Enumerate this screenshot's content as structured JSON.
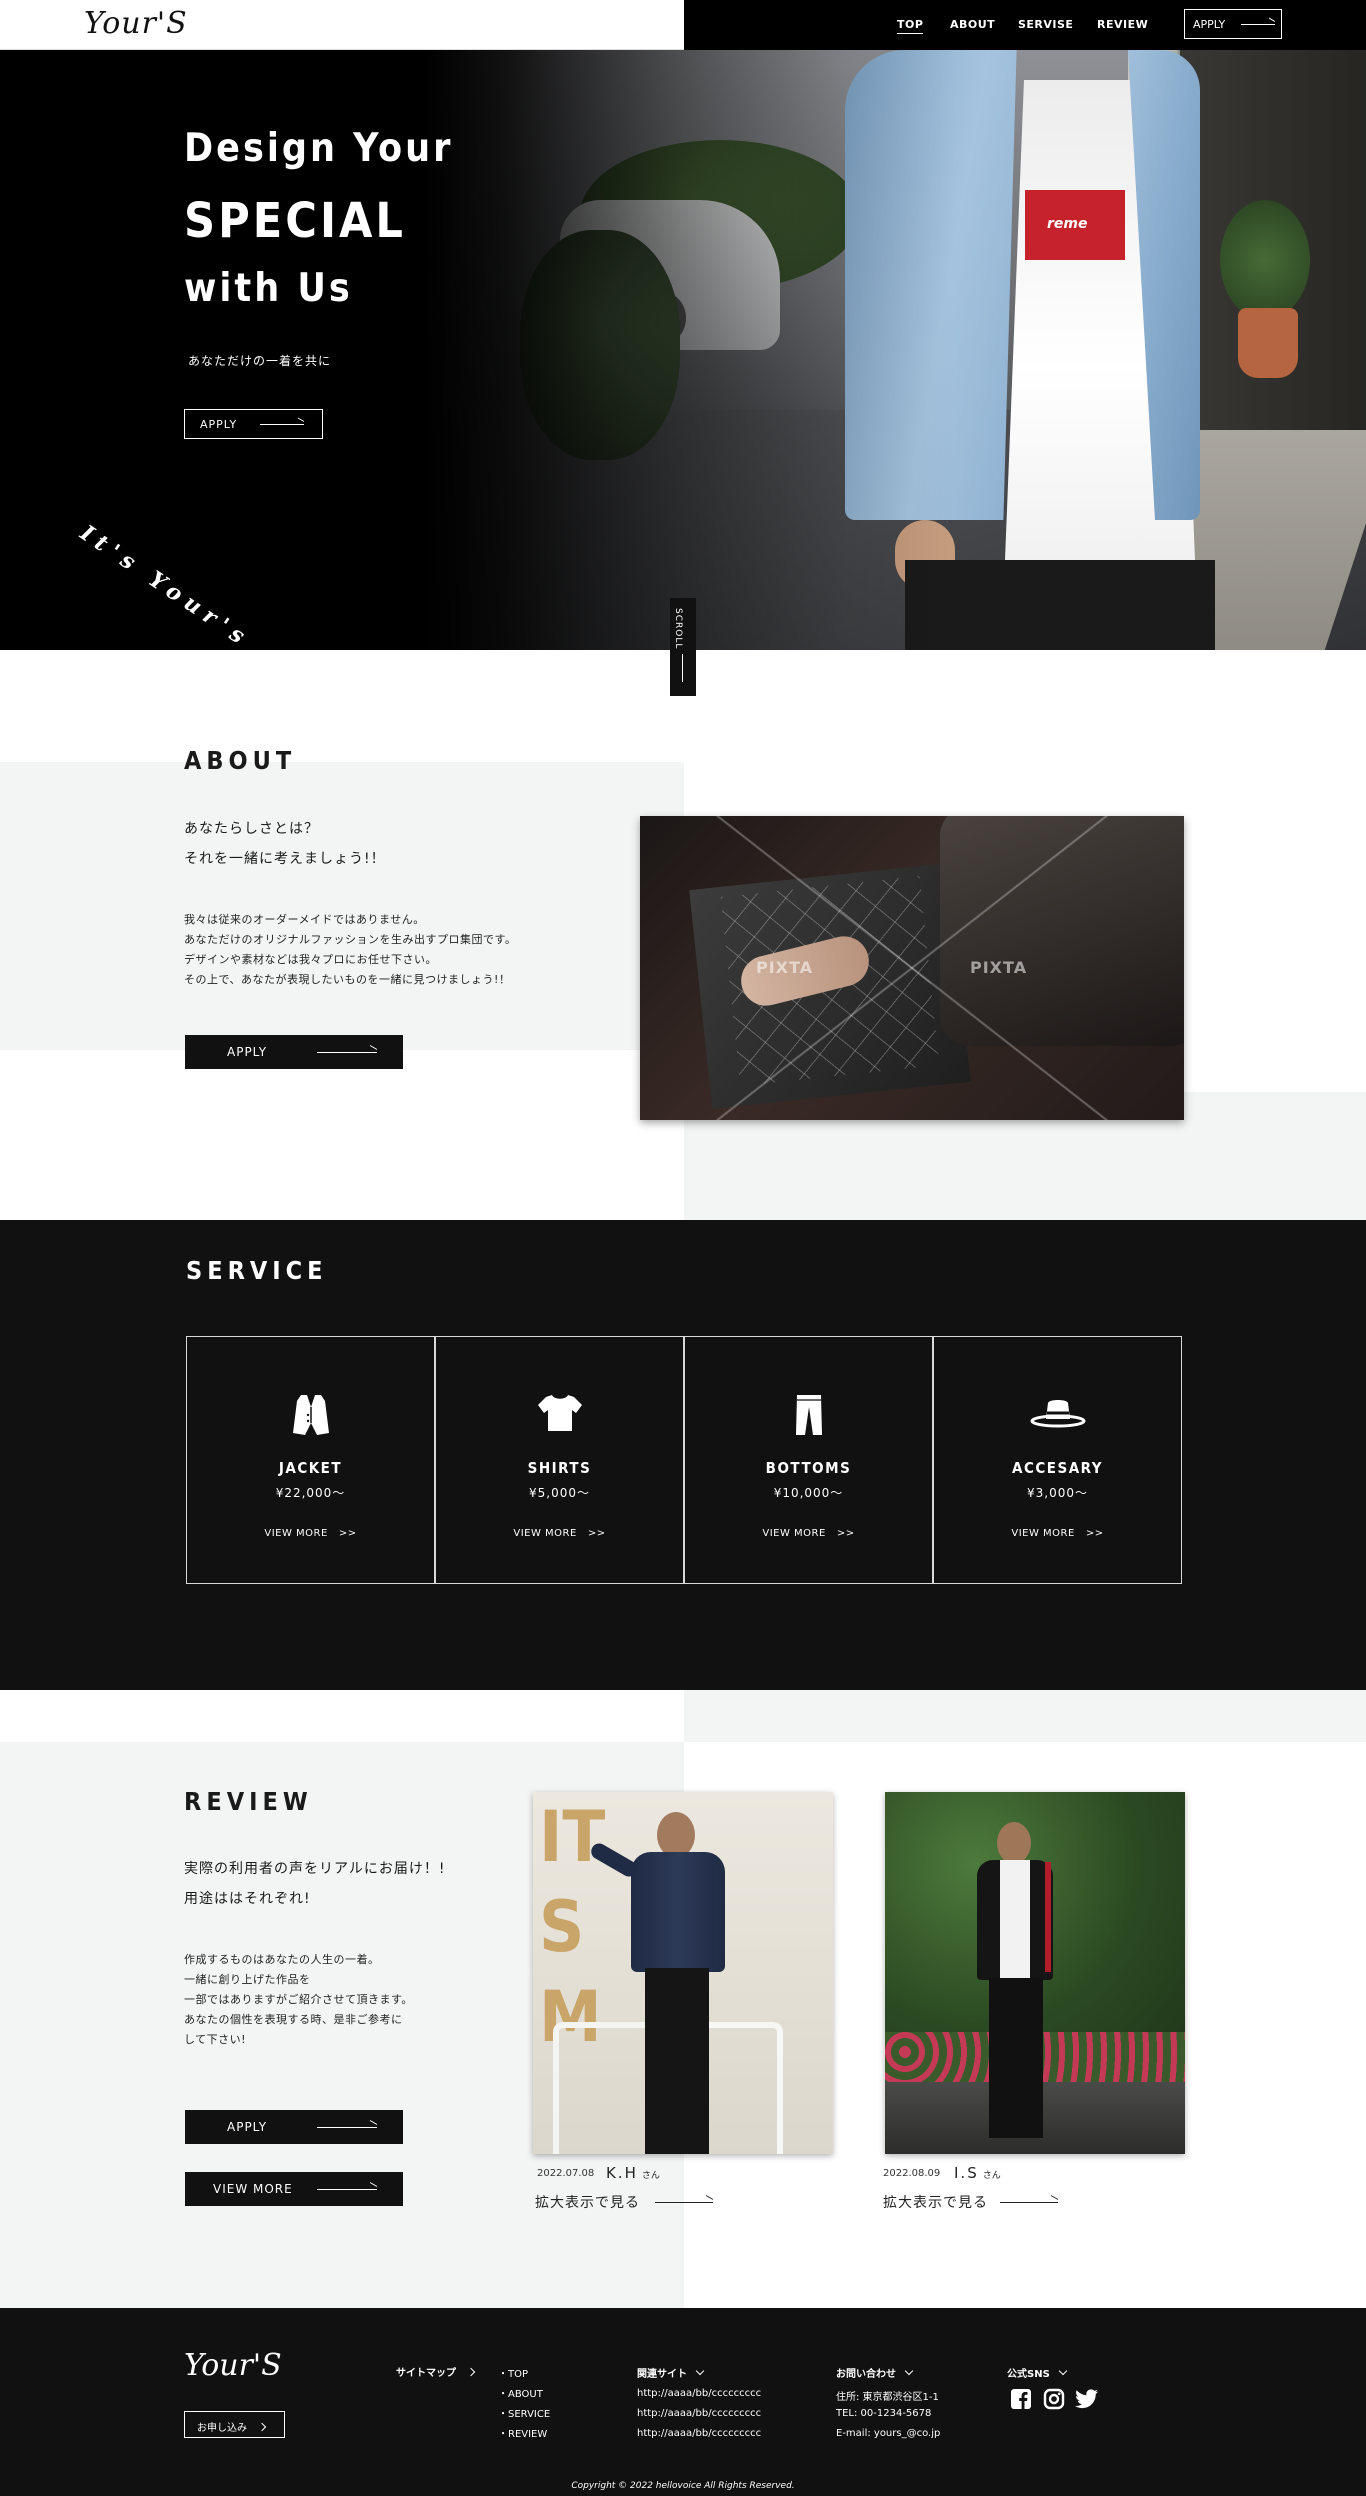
{
  "header": {
    "logo": "Your'S",
    "nav": [
      "TOP",
      "ABOUT",
      "SERVISE",
      "REVIEW"
    ],
    "apply": "APPLY"
  },
  "hero": {
    "line1": "Design Your",
    "line2": "SPECIAL",
    "line3": "with Us",
    "sub": "あなただけの一着を共に",
    "apply": "APPLY",
    "tagline": "It's Your's",
    "scroll": "SCROLL",
    "shirt_print": "reme"
  },
  "about": {
    "title": "ABOUT",
    "lead1": "あなたらしさとは？",
    "lead2": "それを一緒に考えましょう!！",
    "body": [
      "我々は従来のオーダーメイドではありません。",
      "あなただけのオリジナルファッションを生み出すプロ集団です。",
      "デザインや素材などは我々プロにお任せ下さい。",
      "その上で、あなたが表現したいものを一緒に見つけましょう!！"
    ],
    "apply": "APPLY",
    "watermark": "PIXTA"
  },
  "service": {
    "title": "SERVICE",
    "cards": [
      {
        "icon": "vest-icon",
        "name": "JACKET",
        "price": "¥22,000～",
        "more": "VIEW MORE"
      },
      {
        "icon": "tshirt-icon",
        "name": "SHIRTS",
        "price": "¥5,000～",
        "more": "VIEW MORE"
      },
      {
        "icon": "pants-icon",
        "name": "BOTTOMS",
        "price": "¥10,000～",
        "more": "VIEW MORE"
      },
      {
        "icon": "hat-icon",
        "name": "ACCESARY",
        "price": "¥3,000～",
        "more": "VIEW MORE"
      }
    ]
  },
  "review": {
    "title": "REVIEW",
    "lead1": "実際の利用者の声をリアルにお届け！!",
    "lead2": "用途ははそれぞれ!",
    "body": [
      "作成するものはあなたの人生の一着。",
      "一緒に創り上げた作品を",
      "一部ではありますがご紹介させて頂きます。",
      "あなたの個性を表現する時、是非ご参考に",
      "して下さい!"
    ],
    "apply": "APPLY",
    "view_more": "VIEW MORE",
    "wall_letters": "IT\nS\nM",
    "items": [
      {
        "date": "2022.07.08",
        "name": "K.H",
        "suffix": "さん",
        "link": "拡大表示で見る"
      },
      {
        "date": "2022.08.09",
        "name": "I.S",
        "suffix": "さん",
        "link": "拡大表示で見る"
      }
    ]
  },
  "footer": {
    "logo": "Your'S",
    "apply_btn": "お申し込み",
    "sitemap_label": "サイトマップ",
    "sitemap": [
      "・TOP",
      "・ABOUT",
      "・SERVICE",
      "・REVIEW"
    ],
    "related_label": "関連サイト",
    "related": [
      "http://aaaa/bb/ccccccccc",
      "http://aaaa/bb/ccccccccc",
      "http://aaaa/bb/ccccccccc"
    ],
    "contact_label": "お問い合わせ",
    "contact": [
      "住所: 東京都渋谷区1-1",
      "TEL: 00-1234-5678",
      "E-mail: yours_@co.jp"
    ],
    "sns_label": "公式SNS",
    "sns": [
      "facebook-icon",
      "instagram-icon",
      "twitter-icon"
    ],
    "copyright": "Copyright © 2022 hellovoice All Rights Reserved."
  }
}
